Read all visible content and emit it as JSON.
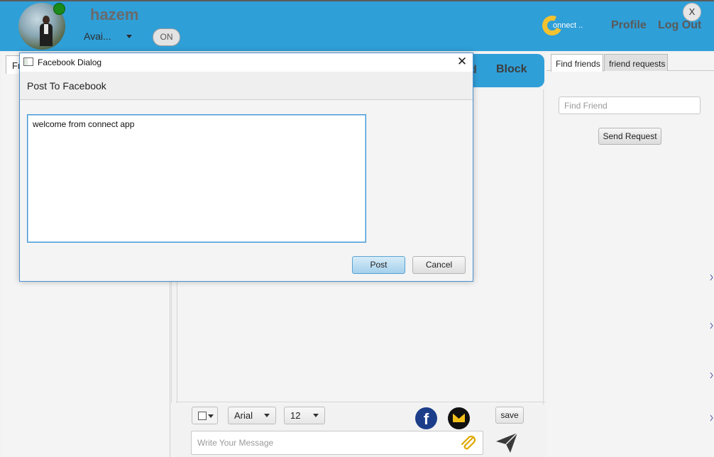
{
  "header": {
    "username": "hazem",
    "presence": "Avai...",
    "toggle": "ON",
    "logo_text": "onnect ..",
    "profile": "Profile",
    "logout": "Log Out",
    "close": "X"
  },
  "left_panel": {
    "tab_label": "Fr"
  },
  "chat": {
    "header_fragment": "d",
    "block": "Block"
  },
  "toolbar": {
    "font": "Arial",
    "size": "12",
    "facebook_glyph": "f",
    "save": "save",
    "message_placeholder": "Write Your Message"
  },
  "right_panel": {
    "tabs": [
      "Find friends",
      "friend requests"
    ],
    "find_placeholder": "Find Friend",
    "send_request": "Send Request"
  },
  "dialog": {
    "title": "Facebook Dialog",
    "close": "✕",
    "heading": "Post To Facebook",
    "text": "welcome from connect app",
    "post": "Post",
    "cancel": "Cancel"
  },
  "colors": {
    "header_blue": "#2f9fd8",
    "status_online": "#1a8a1a",
    "facebook_blue": "#1c3e8a",
    "mail_yellow": "#f3c01a"
  }
}
